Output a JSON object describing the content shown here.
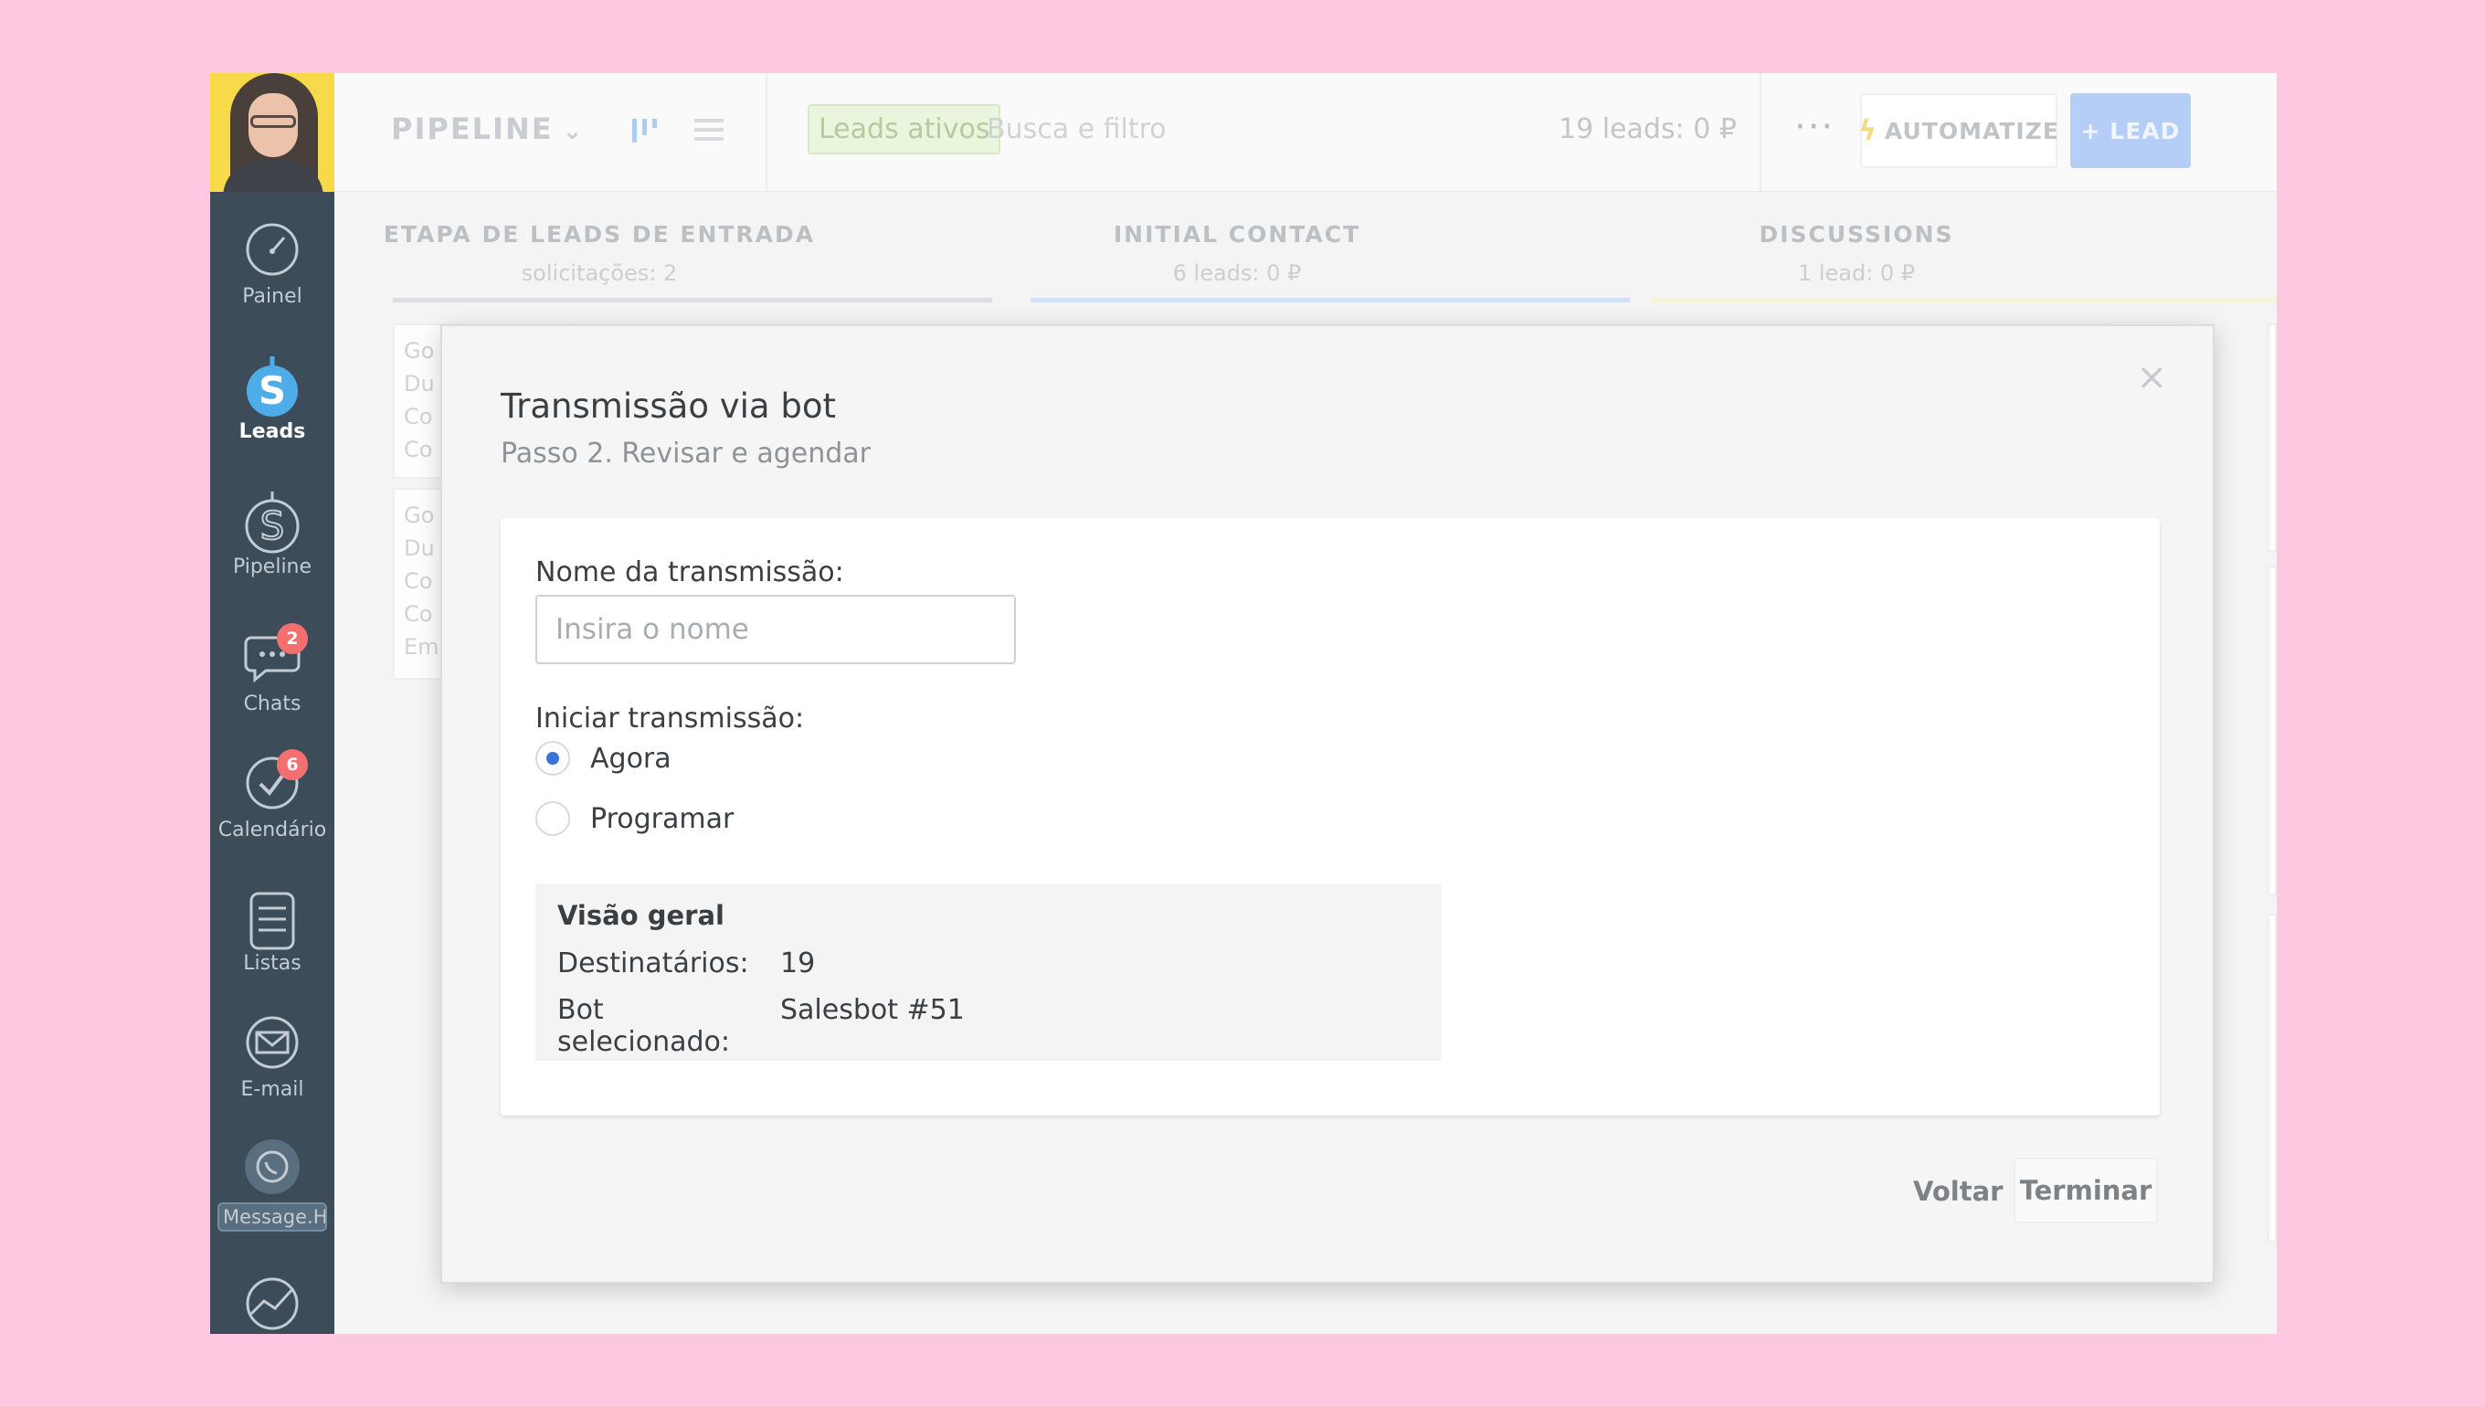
{
  "sidebar": {
    "items": [
      {
        "label": "Painel",
        "icon": "gauge-icon"
      },
      {
        "label": "Leads",
        "icon": "leads-icon"
      },
      {
        "label": "Pipeline",
        "icon": "dollar-icon"
      },
      {
        "label": "Chats",
        "icon": "chat-icon",
        "badge": "2"
      },
      {
        "label": "Calendário",
        "icon": "checkmark-icon",
        "badge": "6"
      },
      {
        "label": "Listas",
        "icon": "list-icon"
      },
      {
        "label": "E-mail",
        "icon": "mail-icon"
      },
      {
        "label": "Message.He",
        "icon": "whatsapp-icon"
      }
    ]
  },
  "topbar": {
    "title": "PIPELINE",
    "chip": "Leads ativos",
    "search_placeholder": "Busca e filtro",
    "lead_count": "19 leads: 0 ₽",
    "more": "···",
    "automate": "AUTOMATIZE",
    "add_lead": "+ LEAD"
  },
  "columns": [
    {
      "title": "ETAPA DE LEADS DE ENTRADA",
      "sub": "solicitações: 2",
      "color": "#d5d8dc"
    },
    {
      "title": "INITIAL CONTACT",
      "sub": "6 leads: 0 ₽",
      "color": "#c6dcf5"
    },
    {
      "title": "DISCUSSIONS",
      "sub": "1 lead: 0 ₽",
      "color": "#f3f5c7"
    }
  ],
  "bg_cards": [
    {
      "lines": [
        "Go",
        "Du",
        "Co",
        "Co"
      ]
    },
    {
      "lines": [
        "Go",
        "Du",
        "Co",
        "Co",
        "Em"
      ]
    }
  ],
  "modal": {
    "close": "×",
    "title": "Transmissão via bot",
    "subtitle": "Passo 2. Revisar e agendar",
    "name_label": "Nome da transmissão:",
    "name_placeholder": "Insira o nome",
    "start_label": "Iniciar transmissão:",
    "options": [
      {
        "label": "Agora",
        "checked": true
      },
      {
        "label": "Programar",
        "checked": false
      }
    ],
    "overview": {
      "heading": "Visão geral",
      "recipients_label": "Destinatários:",
      "recipients_value": "19",
      "bot_label": "Bot selecionado:",
      "bot_value": "Salesbot #51"
    },
    "back": "Voltar",
    "finish": "Terminar"
  },
  "colors": {
    "page_bg": "#fec9e0",
    "sidebar_bg": "#1c2d3d",
    "accent_blue": "#3b73d9",
    "badge_red": "#f25858"
  }
}
